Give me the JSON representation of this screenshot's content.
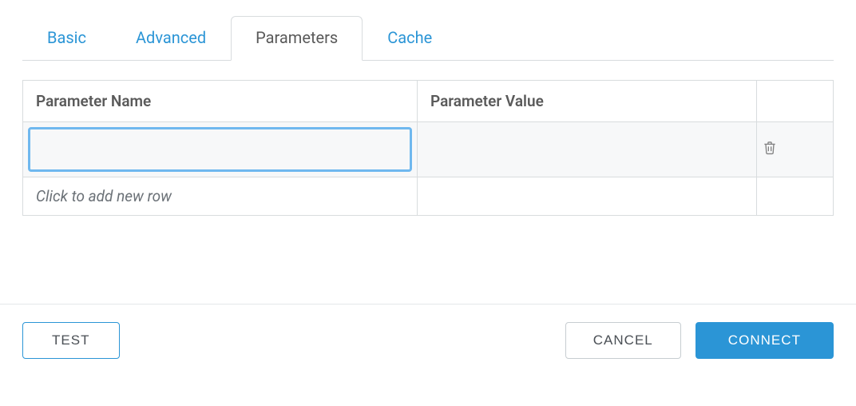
{
  "tabs": {
    "basic": "Basic",
    "advanced": "Advanced",
    "parameters": "Parameters",
    "cache": "Cache",
    "active": "parameters"
  },
  "table": {
    "header_name": "Parameter Name",
    "header_value": "Parameter Value",
    "rows": [
      {
        "name": "",
        "value": ""
      }
    ],
    "add_row_hint": "Click to add new row"
  },
  "footer": {
    "test": "TEST",
    "cancel": "CANCEL",
    "connect": "CONNECT"
  }
}
